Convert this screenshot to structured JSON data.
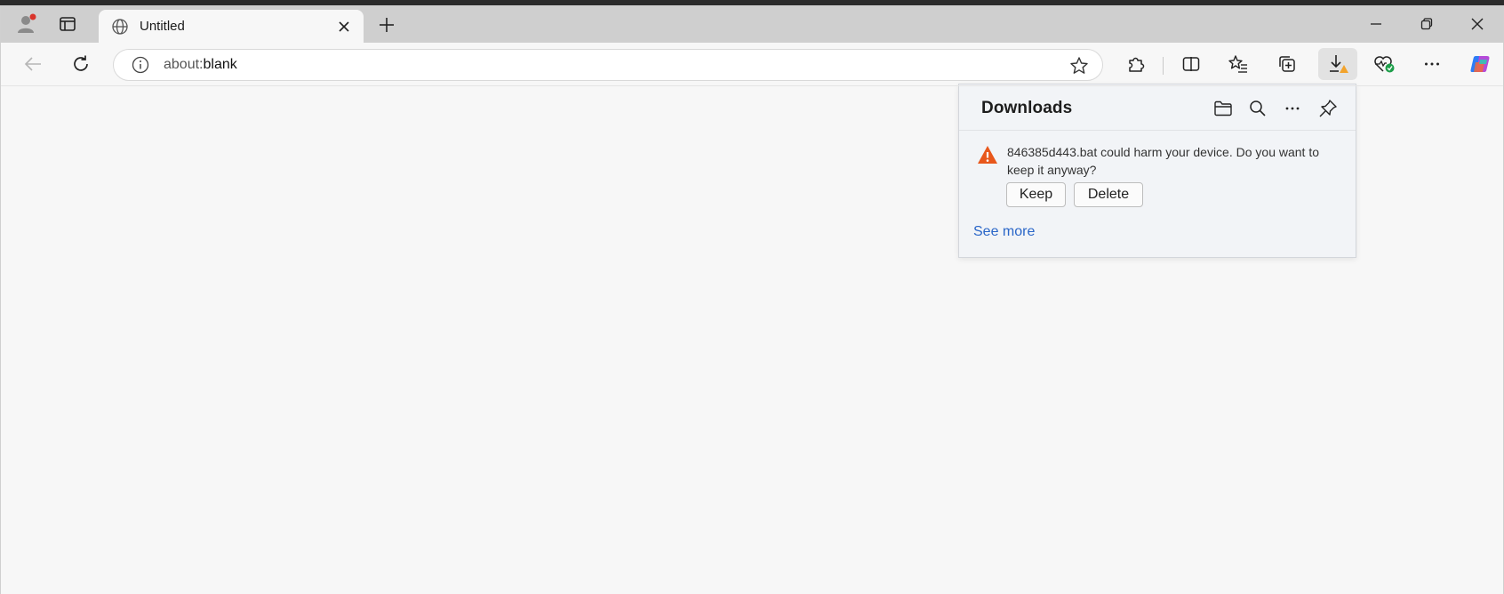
{
  "tab": {
    "title": "Untitled"
  },
  "address_bar": {
    "url_prefix": "about:",
    "url_host": "blank"
  },
  "downloads": {
    "title": "Downloads",
    "warning_message": "846385d443.bat could harm your device. Do you want to keep it anyway?",
    "keep_label": "Keep",
    "delete_label": "Delete",
    "see_more_label": "See more"
  },
  "colors": {
    "accent_link": "#2a66c8",
    "warning": "#e8571b",
    "profile_badge": "#d9342b",
    "heart_badge": "#1e9e4a"
  }
}
